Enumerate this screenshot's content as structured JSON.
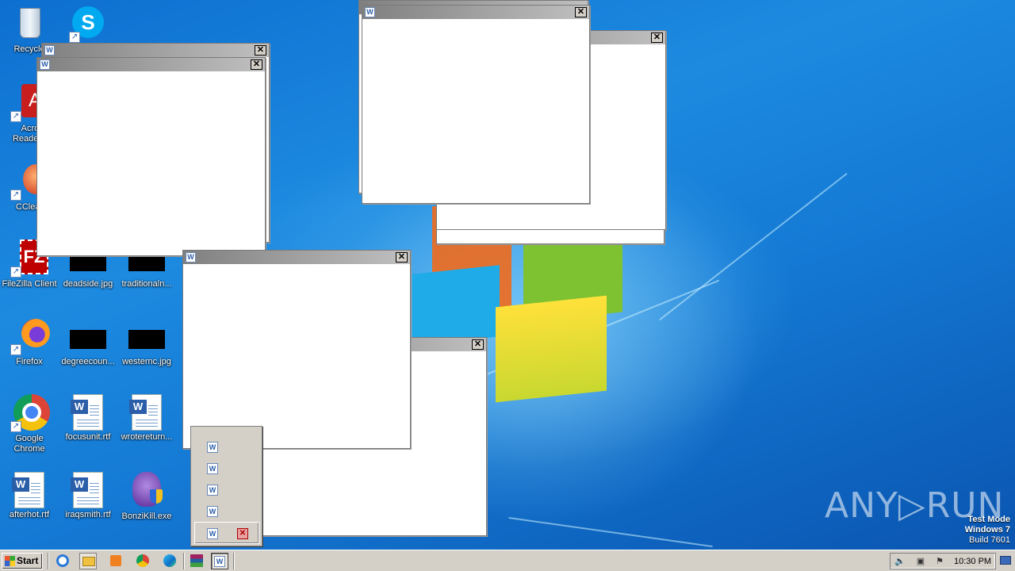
{
  "desktop": {
    "icons": [
      {
        "label": "Recycle Bin",
        "label_visible": "Recycle",
        "icon": "recycle-bin-icon"
      },
      {
        "label": "Skype",
        "icon": "skype-icon"
      },
      {
        "label": "Acrobat Reader",
        "label_line1": "Acrob",
        "label_line2": "Reader",
        "icon": "acrobat-reader-icon"
      },
      {
        "label": "CCleaner",
        "label_visible": "CClear",
        "icon": "ccleaner-icon"
      },
      {
        "label": "FileZilla Client",
        "icon": "filezilla-icon"
      },
      {
        "label": "deadside.jpg",
        "icon": "image-file-icon"
      },
      {
        "label": "traditionaln...",
        "icon": "image-file-icon"
      },
      {
        "label": "Firefox",
        "icon": "firefox-icon"
      },
      {
        "label": "degreecoun...",
        "icon": "image-file-icon"
      },
      {
        "label": "westernc.jpg",
        "icon": "image-file-icon"
      },
      {
        "label_line1": "Google",
        "label_line2": "Chrome",
        "icon": "chrome-icon"
      },
      {
        "label": "focusunit.rtf",
        "icon": "word-document-icon"
      },
      {
        "label": "wrotereturn...",
        "icon": "word-document-icon"
      },
      {
        "label": "afterhot.rtf",
        "icon": "word-document-icon"
      },
      {
        "label": "iraqsmith.rtf",
        "icon": "word-document-icon"
      },
      {
        "label": "BonziKill.exe",
        "icon": "bonzi-icon"
      }
    ]
  },
  "windows": {
    "close_glyph": "✕",
    "app_glyph": "W"
  },
  "tray_menu": {
    "app_glyph": "W",
    "close_glyph": "✕"
  },
  "taskbar": {
    "start_label": "Start",
    "clock": "10:30 PM"
  },
  "watermark": {
    "mode": "Test Mode",
    "os": "Windows 7",
    "build": "Build 7601",
    "brand": "ANY▷RUN"
  }
}
